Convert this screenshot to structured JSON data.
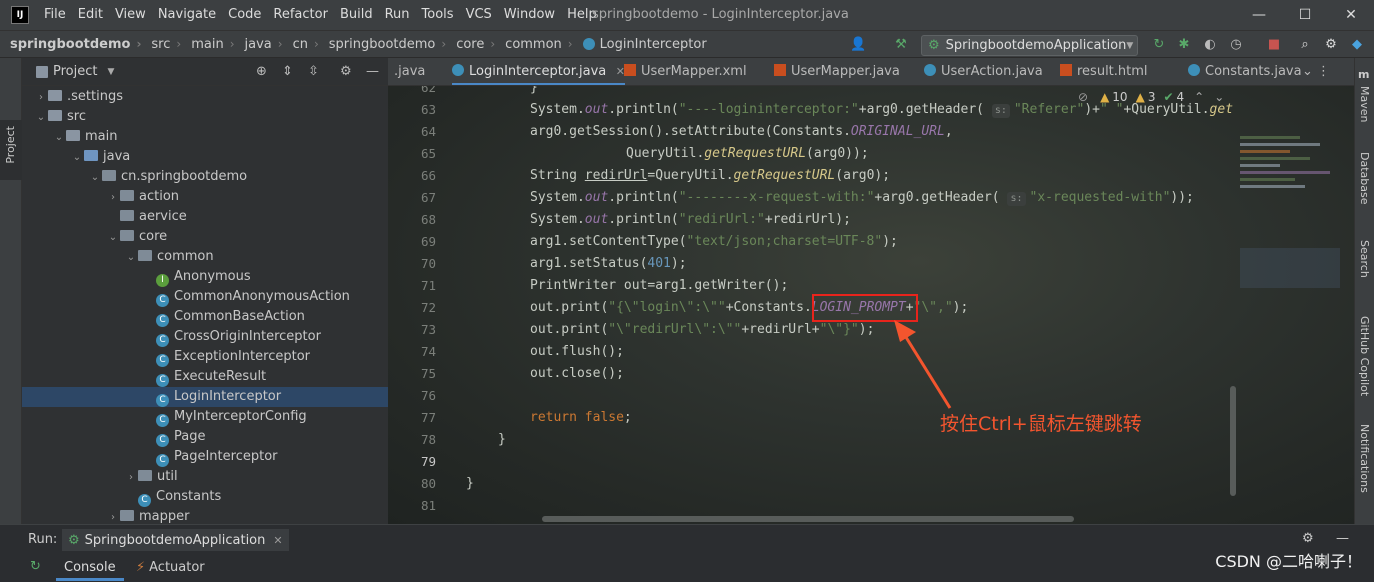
{
  "window": {
    "logo": "IJ",
    "title": "springbootdemo - LoginInterceptor.java",
    "menu": [
      "File",
      "Edit",
      "View",
      "Navigate",
      "Code",
      "Refactor",
      "Build",
      "Run",
      "Tools",
      "VCS",
      "Window",
      "Help"
    ],
    "controls": {
      "minimize": "—",
      "maximize": "☐",
      "close": "✕"
    }
  },
  "breadcrumb": [
    "springbootdemo",
    "src",
    "main",
    "java",
    "cn",
    "springbootdemo",
    "core",
    "common",
    "LoginInterceptor"
  ],
  "toolbar": {
    "run_config": "SpringbootdemoApplication"
  },
  "left_stripe": {
    "project_label": "Project"
  },
  "project_panel": {
    "title": "Project",
    "tree": [
      {
        "label": ".settings",
        "depth": 1,
        "kind": "folder",
        "expanded": false
      },
      {
        "label": "src",
        "depth": 1,
        "kind": "folder",
        "expanded": true
      },
      {
        "label": "main",
        "depth": 2,
        "kind": "folder",
        "expanded": true
      },
      {
        "label": "java",
        "depth": 3,
        "kind": "src",
        "expanded": true
      },
      {
        "label": "cn.springbootdemo",
        "depth": 4,
        "kind": "pkg",
        "expanded": true
      },
      {
        "label": "action",
        "depth": 5,
        "kind": "pkg",
        "expanded": false
      },
      {
        "label": "aervice",
        "depth": 5,
        "kind": "pkg",
        "expanded": null
      },
      {
        "label": "core",
        "depth": 5,
        "kind": "pkg",
        "expanded": true
      },
      {
        "label": "common",
        "depth": 6,
        "kind": "pkg",
        "expanded": true
      },
      {
        "label": "Anonymous",
        "depth": 7,
        "kind": "interface",
        "expanded": null
      },
      {
        "label": "CommonAnonymousAction",
        "depth": 7,
        "kind": "class",
        "expanded": null
      },
      {
        "label": "CommonBaseAction",
        "depth": 7,
        "kind": "class",
        "expanded": null
      },
      {
        "label": "CrossOriginInterceptor",
        "depth": 7,
        "kind": "class",
        "expanded": null
      },
      {
        "label": "ExceptionInterceptor",
        "depth": 7,
        "kind": "class",
        "expanded": null
      },
      {
        "label": "ExecuteResult",
        "depth": 7,
        "kind": "class",
        "expanded": null
      },
      {
        "label": "LoginInterceptor",
        "depth": 7,
        "kind": "class",
        "expanded": null,
        "selected": true
      },
      {
        "label": "MyInterceptorConfig",
        "depth": 7,
        "kind": "class",
        "expanded": null
      },
      {
        "label": "Page",
        "depth": 7,
        "kind": "class",
        "expanded": null
      },
      {
        "label": "PageInterceptor",
        "depth": 7,
        "kind": "class",
        "expanded": null
      },
      {
        "label": "util",
        "depth": 6,
        "kind": "pkg",
        "expanded": false
      },
      {
        "label": "Constants",
        "depth": 6,
        "kind": "class",
        "expanded": null
      },
      {
        "label": "mapper",
        "depth": 5,
        "kind": "pkg",
        "expanded": false
      }
    ]
  },
  "editor_tabs": [
    {
      "label": ".java",
      "icon": "none",
      "active": false
    },
    {
      "label": "LoginInterceptor.java",
      "icon": "class",
      "active": true
    },
    {
      "label": "UserMapper.xml",
      "icon": "xml",
      "active": false
    },
    {
      "label": "UserMapper.java",
      "icon": "xml",
      "active": false
    },
    {
      "label": "UserAction.java",
      "icon": "class",
      "active": false
    },
    {
      "label": "result.html",
      "icon": "xml",
      "active": false
    },
    {
      "label": "Constants.java",
      "icon": "class",
      "active": false
    }
  ],
  "inspection": {
    "warnings": "10",
    "weak": "3",
    "ok": "4"
  },
  "code": {
    "line_numbers": [
      "62",
      "63",
      "64",
      "65",
      "66",
      "67",
      "68",
      "69",
      "70",
      "71",
      "72",
      "73",
      "74",
      "75",
      "76",
      "77",
      "78",
      "79",
      "80",
      "81"
    ]
  },
  "callout": "按住Ctrl+鼠标左键跳转",
  "right_stripe": [
    "Maven",
    "Database",
    "Search",
    "GitHub Copilot",
    "Notifications"
  ],
  "run_panel": {
    "label": "Run:",
    "config": "SpringbootdemoApplication",
    "tabs": [
      "Console",
      "Actuator"
    ]
  },
  "watermark": "CSDN @二哈喇子！"
}
